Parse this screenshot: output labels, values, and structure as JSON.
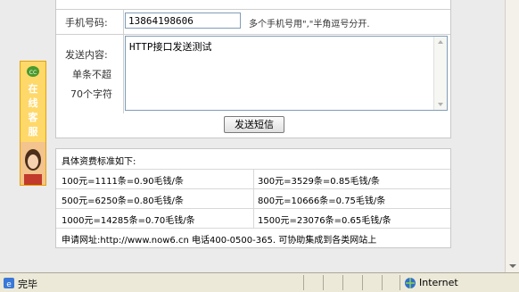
{
  "form": {
    "phone_label": "手机号码:",
    "phone_value": "13864198606",
    "phone_hint": "多个手机号用\",\"半角逗号分开.",
    "content_label": "发送内容:",
    "content_note1": "单条不超",
    "content_note2": "70个字符",
    "content_value": "HTTP接口发送测试",
    "send_button": "发送短信"
  },
  "pricing": {
    "title": "具体资费标准如下:",
    "rows": [
      [
        "100元=1111条=0.90毛钱/条",
        "300元=3529条=0.85毛钱/条"
      ],
      [
        "500元=6250条=0.80毛钱/条",
        "800元=10666条=0.75毛钱/条"
      ],
      [
        "1000元=14285条=0.70毛钱/条",
        "1500元=23076条=0.65毛钱/条"
      ]
    ],
    "footer": "申请网址:http://www.now6.cn 电话400-0500-365. 可协助集成到各类网站上"
  },
  "service_widget": {
    "chars": [
      "在",
      "线",
      "客",
      "服"
    ]
  },
  "statusbar": {
    "status": "完毕",
    "zone": "Internet"
  },
  "colors": {
    "accent_orange": "#ffd86a",
    "border": "#c8c8c8"
  }
}
